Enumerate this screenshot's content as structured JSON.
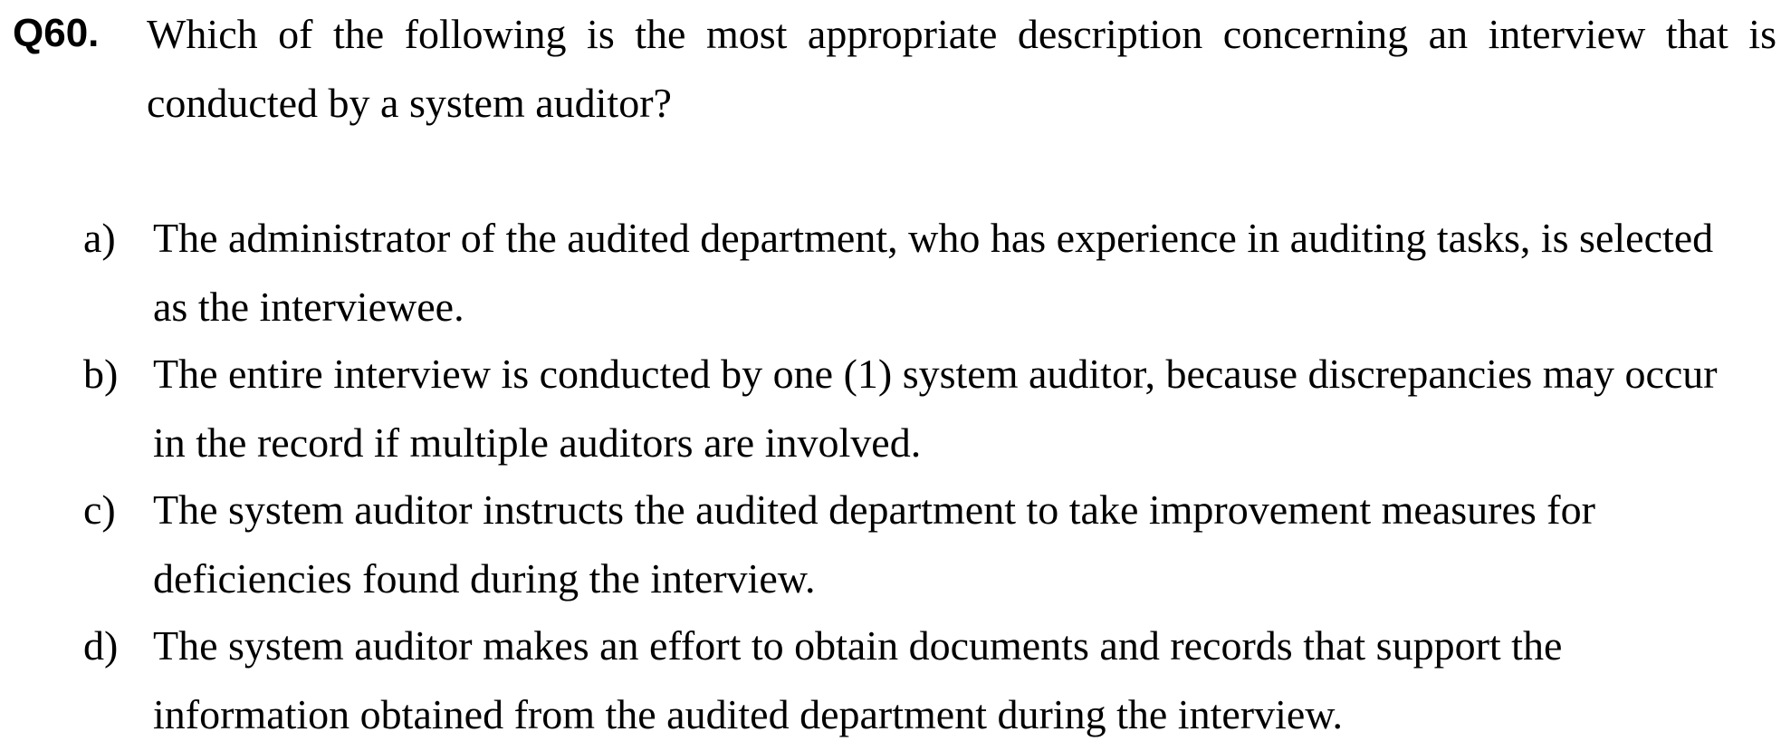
{
  "question": {
    "number": "Q60.",
    "text": "Which of the following is the most appropriate description concerning an interview that is conducted by a system auditor?"
  },
  "options": [
    {
      "letter": "a)",
      "text": "The administrator of the audited department, who has experience in auditing tasks, is selected as the interviewee."
    },
    {
      "letter": "b)",
      "text": "The entire interview is conducted by one (1) system auditor, because discrepancies may occur in the record if multiple auditors are involved."
    },
    {
      "letter": "c)",
      "text": "The system auditor instructs the audited department to take improvement measures for deficiencies found during the interview."
    },
    {
      "letter": "d)",
      "text": "The system auditor makes an effort to obtain documents and records that support the information obtained from the audited department during the interview."
    }
  ]
}
